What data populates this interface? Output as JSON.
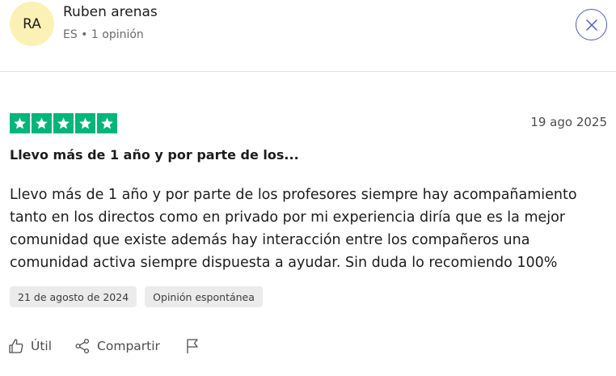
{
  "user": {
    "initials": "RA",
    "name": "Ruben arenas",
    "meta": "ES • 1 opinión"
  },
  "review": {
    "rating": 5,
    "date": "19 ago 2025",
    "title": "Llevo más de 1 año y por parte de los...",
    "body": "Llevo más de 1 año y por parte de los profesores siempre hay acompañamiento tanto en los directos como en privado por mi experiencia diría que es la mejor comunidad que existe además hay interacción entre los compañeros una comunidad activa siempre dispuesta a ayudar. Sin duda lo recomiendo 100%",
    "tags": [
      "21 de agosto de 2024",
      "Opinión espontánea"
    ]
  },
  "actions": {
    "useful_label": "Útil",
    "share_label": "Compartir"
  },
  "icons": {
    "close": "close-icon",
    "star": "star-icon",
    "useful": "thumbs-up-icon",
    "share": "share-icon",
    "report": "flag-icon"
  },
  "colors": {
    "star_green": "#00b67a",
    "avatar_bg": "#fcf1b4",
    "close_accent": "#4a5fc1"
  }
}
